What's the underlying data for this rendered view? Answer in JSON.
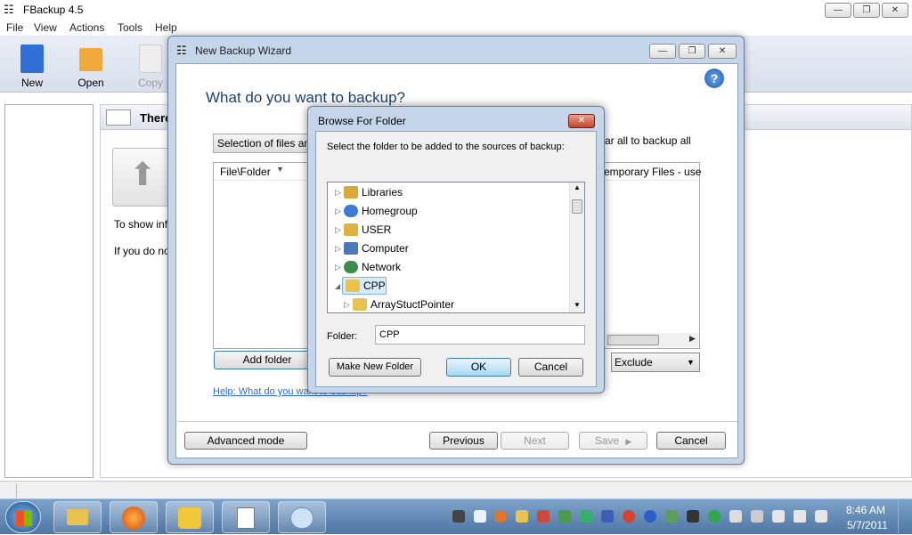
{
  "app": {
    "title": "FBackup  4.5",
    "menu": [
      "File",
      "View",
      "Actions",
      "Tools",
      "Help"
    ],
    "toolbar": [
      {
        "label": "New",
        "icon": "new-document-icon"
      },
      {
        "label": "Open",
        "icon": "open-folder-icon"
      },
      {
        "label": "Copy",
        "icon": "copy-icon"
      }
    ],
    "main_heading": "There",
    "main_text1": "To show inf",
    "main_text2": "If you do no"
  },
  "wizard": {
    "title": "New Backup Wizard",
    "heading": "What do you want to backup?",
    "selection_text": "Selection of files an",
    "clear_text": "ar all to backup all",
    "column_header": "File\\Folder",
    "temp_files": "emporary Files - use",
    "add_folder": "Add folder",
    "exclude": "Exclude",
    "help_link": "Help: What do you want to backup?",
    "advanced_mode": "Advanced mode",
    "previous": "Previous",
    "next": "Next",
    "save": "Save",
    "cancel": "Cancel"
  },
  "browse": {
    "title": "Browse For Folder",
    "instruction": "Select the folder to be added to the sources of backup:",
    "tree": [
      {
        "label": "Libraries",
        "icon": "libraries-icon",
        "color": "#d9a93a"
      },
      {
        "label": "Homegroup",
        "icon": "homegroup-icon",
        "color": "#3b7bd6"
      },
      {
        "label": "USER",
        "icon": "user-folder-icon",
        "color": "#e0b040"
      },
      {
        "label": "Computer",
        "icon": "computer-icon",
        "color": "#4a78b8"
      },
      {
        "label": "Network",
        "icon": "network-icon",
        "color": "#3c8c4c"
      },
      {
        "label": "CPP",
        "icon": "cpp-folder-icon",
        "color": "#e8c350"
      },
      {
        "label": "ArrayStuctPointer",
        "icon": "folder-icon",
        "color": "#e8c350"
      }
    ],
    "folder_label": "Folder:",
    "folder_value": "CPP",
    "make_new_folder": "Make New Folder",
    "ok": "OK",
    "cancel": "Cancel"
  },
  "taskbar": {
    "time": "8:46 AM",
    "date": "5/7/2011"
  }
}
